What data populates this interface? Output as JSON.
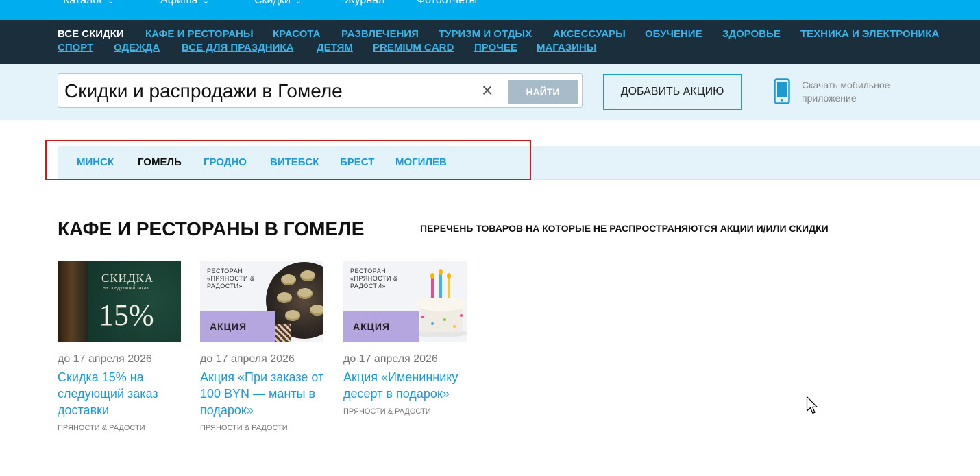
{
  "topnav": {
    "items": [
      {
        "label": "Каталог"
      },
      {
        "label": "Афиша"
      },
      {
        "label": "Скидки"
      },
      {
        "label": "Журнал"
      },
      {
        "label": "Фотоотчеты"
      }
    ]
  },
  "categories": [
    {
      "label": "Все скидки",
      "active": true
    },
    {
      "label": "Кафе и рестораны"
    },
    {
      "label": "Красота"
    },
    {
      "label": "Развлечения"
    },
    {
      "label": "Туризм и отдых"
    },
    {
      "label": "Аксессуары"
    },
    {
      "label": "Обучение"
    },
    {
      "label": "Здоровье"
    },
    {
      "label": "Техника и электроника"
    },
    {
      "label": "Спорт"
    },
    {
      "label": "Одежда"
    },
    {
      "label": "Все для праздника"
    },
    {
      "label": "Детям"
    },
    {
      "label": "Premium card"
    },
    {
      "label": "Прочее"
    },
    {
      "label": "Магазины"
    }
  ],
  "search": {
    "query": "Скидки и распродажи в Гомеле",
    "clear_icon": "close-icon",
    "button_label": "НАЙТИ"
  },
  "add_promo": {
    "label": "ДОБАВИТЬ АКЦИЮ"
  },
  "app": {
    "icon": "mobile-phone-icon",
    "line1": "Скачать мобильное",
    "line2": "приложение"
  },
  "cities": [
    {
      "label": "МИНСК"
    },
    {
      "label": "ГОМЕЛЬ",
      "active": true
    },
    {
      "label": "ГРОДНО"
    },
    {
      "label": "ВИТЕБСК"
    },
    {
      "label": "БРЕСТ"
    },
    {
      "label": "МОГИЛЕВ"
    }
  ],
  "page": {
    "heading": "КАФЕ И РЕСТОРАНЫ В ГОМЕЛЕ",
    "exclusions_link": "ПЕРЕЧЕНЬ ТОВАРОВ НА КОТОРЫЕ НЕ РАСПРОСТРАНЯЮТСЯ АКЦИИ И/ИЛИ СКИДКИ"
  },
  "colors": {
    "topnav": "#00aeef",
    "catbar": "#1b2e3c",
    "link": "#1a9ad6",
    "band": "#e4f3fa",
    "highlight": "#d41818"
  },
  "cards": [
    {
      "thumb": {
        "headline": "СКИДКА",
        "sub": "на следующий заказ",
        "value": "15%"
      },
      "date": "до 17 апреля 2026",
      "title": "Скидка 15% на следующий заказ доставки",
      "vendor": "ПРЯНОСТИ & РАДОСТИ"
    },
    {
      "thumb": {
        "label": "РЕСТОРАН «ПРЯНОСТИ & РАДОСТИ»",
        "badge": "АКЦИЯ"
      },
      "date": "до 17 апреля 2026",
      "title": "Акция «При заказе от 100 BYN — манты в подарок»",
      "vendor": "ПРЯНОСТИ & РАДОСТИ"
    },
    {
      "thumb": {
        "label": "РЕСТОРАН «ПРЯНОСТИ & РАДОСТИ»",
        "badge": "АКЦИЯ"
      },
      "date": "до 17 апреля 2026",
      "title": "Акция «Имениннику десерт в подарок»",
      "vendor": "ПРЯНОСТИ & РАДОСТИ"
    }
  ]
}
